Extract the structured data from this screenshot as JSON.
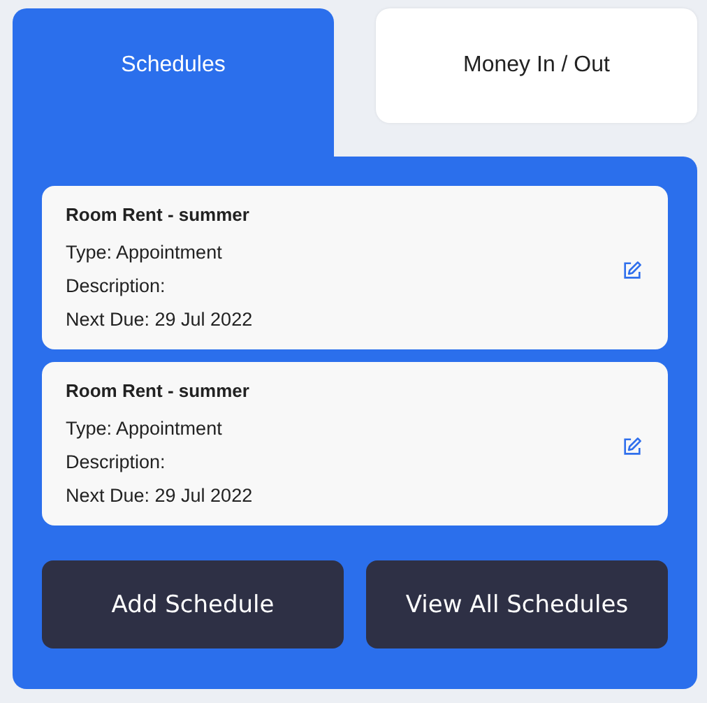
{
  "tabs": [
    {
      "label": "Schedules",
      "selected": true
    },
    {
      "label": "Money In / Out",
      "selected": false
    }
  ],
  "schedules": [
    {
      "title": "Room Rent - summer",
      "type": "Type: Appointment",
      "description": "Description:",
      "next_due": "Next Due: 29 Jul 2022"
    },
    {
      "title": "Room Rent - summer",
      "type": "Type: Appointment",
      "description": "Description:",
      "next_due": "Next Due: 29 Jul 2022"
    }
  ],
  "buttons": [
    "Add Schedule",
    "View All Schedules"
  ]
}
